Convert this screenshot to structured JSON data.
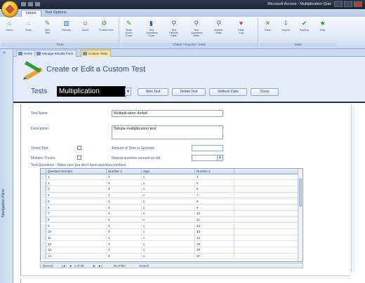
{
  "window": {
    "title": "Microsoft Access - Multiplication Quiz",
    "office_button_icon": "office-logo-icon"
  },
  "ribbon": {
    "tabs": [
      "Home",
      "Test Options"
    ],
    "groups": [
      {
        "label": "Tools",
        "buttons": [
          {
            "label": "Home",
            "icon": "home-icon",
            "color": "#4a7cc0"
          },
          {
            "label": "Tests",
            "icon": "house-icon",
            "color": "#e0a030"
          },
          {
            "label": "Take Test",
            "icon": "pencil-icon",
            "color": "#3a9a3a"
          },
          {
            "label": "Results",
            "icon": "chart-icon",
            "color": "#2f6fb8"
          },
          {
            "label": "Users",
            "icon": "users-icon",
            "color": "#7a5030"
          },
          {
            "label": "Preferences",
            "icon": "settings-icon",
            "color": "#5a7a40"
          }
        ]
      },
      {
        "label": "Charts / Reports / Stats",
        "buttons": [
          {
            "label": "Tests Score Chart",
            "icon": "edit-icon",
            "color": "#3a9a3a"
          },
          {
            "label": "Test Questions Chart",
            "icon": "bar-chart-icon",
            "color": "#3a5fb0"
          },
          {
            "label": "Test Results Stats",
            "icon": "magnifier-icon",
            "color": "#3a6ab0"
          },
          {
            "label": "Test Questions Stats",
            "icon": "magnifier-icon",
            "color": "#3a6ab0"
          },
          {
            "label": "Answer Stats",
            "icon": "magnifier-icon",
            "color": "#3a6ab0"
          },
          {
            "label": "Stats Log",
            "icon": "heart-icon",
            "color": "#d03a3a"
          }
        ]
      },
      {
        "label": "Data",
        "buttons": [
          {
            "label": "Clear",
            "icon": "clear-icon",
            "color": "#3a9a3a"
          },
          {
            "label": "Import",
            "icon": "import-icon",
            "color": "#3a6ab0"
          },
          {
            "label": "Backup",
            "icon": "check-icon",
            "color": "#3a9a3a"
          },
          {
            "label": "Help",
            "icon": "star-icon",
            "color": "#2f8a2f"
          }
        ]
      }
    ]
  },
  "doc_tabs": [
    {
      "label": "Home",
      "active": false
    },
    {
      "label": "Manage Results Form",
      "active": false
    },
    {
      "label": "Custom Tests",
      "active": true
    }
  ],
  "navigation": {
    "label": "Navigation Pane"
  },
  "form": {
    "title": "Create or Edit a Custom Test",
    "tests_label": "Tests",
    "selected_test": "Multiplication",
    "buttons": {
      "new_test": "New Test",
      "delete_test": "Delete Test",
      "refresh_data": "Refresh Data",
      "close": "Close"
    },
    "fields": {
      "test_name_label": "Test Name",
      "test_name_value": "Multiplication 4x4x4",
      "description_label": "Description",
      "description_value": "Simple multiplication test",
      "timed_label": "Timed Test",
      "amount_time_label": "Amount of Time in Seconds",
      "amount_time_value": "",
      "multiple_choice_label": "Multiple Choice",
      "repeat_label": "Repeat question amount on fail",
      "repeat_value": "",
      "grid_caption": "Test Questions - Make sure you don't have question numbers"
    },
    "grid": {
      "columns": [
        "Question Number",
        "Number 1",
        "Sign",
        "Number 2"
      ],
      "rows": [
        [
          "1",
          "4",
          "x",
          "4"
        ],
        [
          "2",
          "4",
          "x",
          "5"
        ],
        [
          "3",
          "4",
          "x",
          "6"
        ],
        [
          "4",
          "4",
          "x",
          "7"
        ],
        [
          "5",
          "4",
          "x",
          "8"
        ],
        [
          "6",
          "4",
          "x",
          "9"
        ],
        [
          "7",
          "4",
          "x",
          "10"
        ],
        [
          "8",
          "4",
          "x",
          "11"
        ],
        [
          "9",
          "4",
          "x",
          "12"
        ],
        [
          "10",
          "4",
          "x",
          "13"
        ],
        [
          "11",
          "4",
          "x",
          "14"
        ],
        [
          "12",
          "4",
          "x",
          "15"
        ],
        [
          "13",
          "4",
          "x",
          "16"
        ],
        [
          "14",
          "4",
          "x",
          "17"
        ]
      ]
    },
    "record_nav": {
      "record_label": "Record:",
      "position": "1 of 25",
      "filter": "No Filter",
      "search": "Search"
    }
  }
}
